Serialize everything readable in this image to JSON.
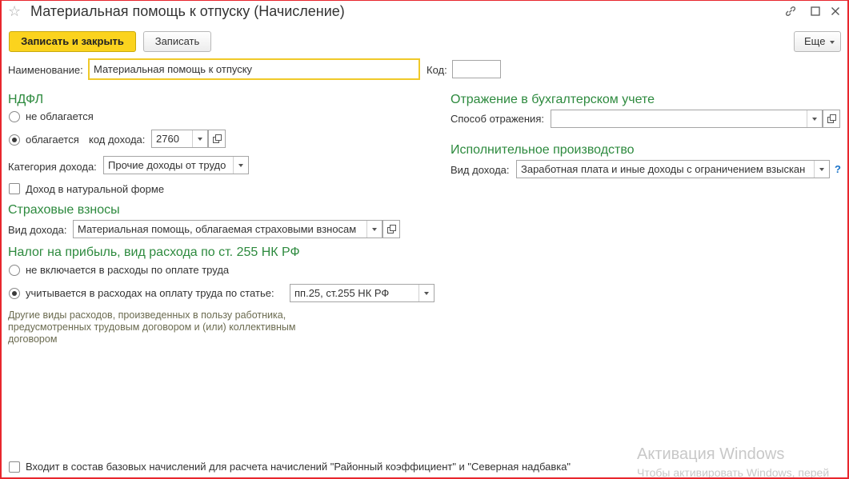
{
  "window": {
    "title": "Материальная помощь к отпуску (Начисление)"
  },
  "toolbar": {
    "save_close_label": "Записать и закрыть",
    "save_label": "Записать",
    "more_label": "Еще"
  },
  "header": {
    "name_label": "Наименование:",
    "name_value": "Материальная помощь к отпуску",
    "code_label": "Код:",
    "code_value": ""
  },
  "ndfl": {
    "section_title": "НДФЛ",
    "not_taxed_label": "не облагается",
    "taxed_label": "облагается",
    "income_code_label": "код дохода:",
    "income_code_value": "2760",
    "category_label": "Категория дохода:",
    "category_value": "Прочие доходы от трудо",
    "in_kind_label": "Доход в натуральной форме",
    "selected": "taxed"
  },
  "insurance": {
    "section_title": "Страховые взносы",
    "income_type_label": "Вид дохода:",
    "income_type_value": "Материальная помощь, облагаемая страховыми взносам"
  },
  "profit_tax": {
    "section_title": "Налог на прибыль, вид расхода по ст. 255 НК РФ",
    "not_included_label": "не включается в расходы по оплате труда",
    "included_label": "учитывается в расходах на оплату труда по статье:",
    "article_value": "пп.25, ст.255 НК РФ",
    "note": "Другие виды расходов, произведенных в пользу работника, предусмотренных трудовым договором и (или) коллективным договором",
    "selected": "included"
  },
  "accounting": {
    "section_title": "Отражение в бухгалтерском учете",
    "method_label": "Способ отражения:",
    "method_value": ""
  },
  "enforcement": {
    "section_title": "Исполнительное производство",
    "income_type_label": "Вид дохода:",
    "income_type_value": "Заработная плата и иные доходы с ограничением взыскан",
    "help_label": "?"
  },
  "footer": {
    "base_accruals_label": "Входит в состав базовых начислений для расчета начислений \"Районный коэффициент\" и \"Северная надбавка\""
  },
  "watermark": {
    "line1": "Активация Windows",
    "line2": "Чтобы активировать Windows, перей"
  },
  "colors": {
    "accent": "#fbd31e",
    "section_green": "#2d8a3e",
    "frame_red": "#e8262d"
  }
}
